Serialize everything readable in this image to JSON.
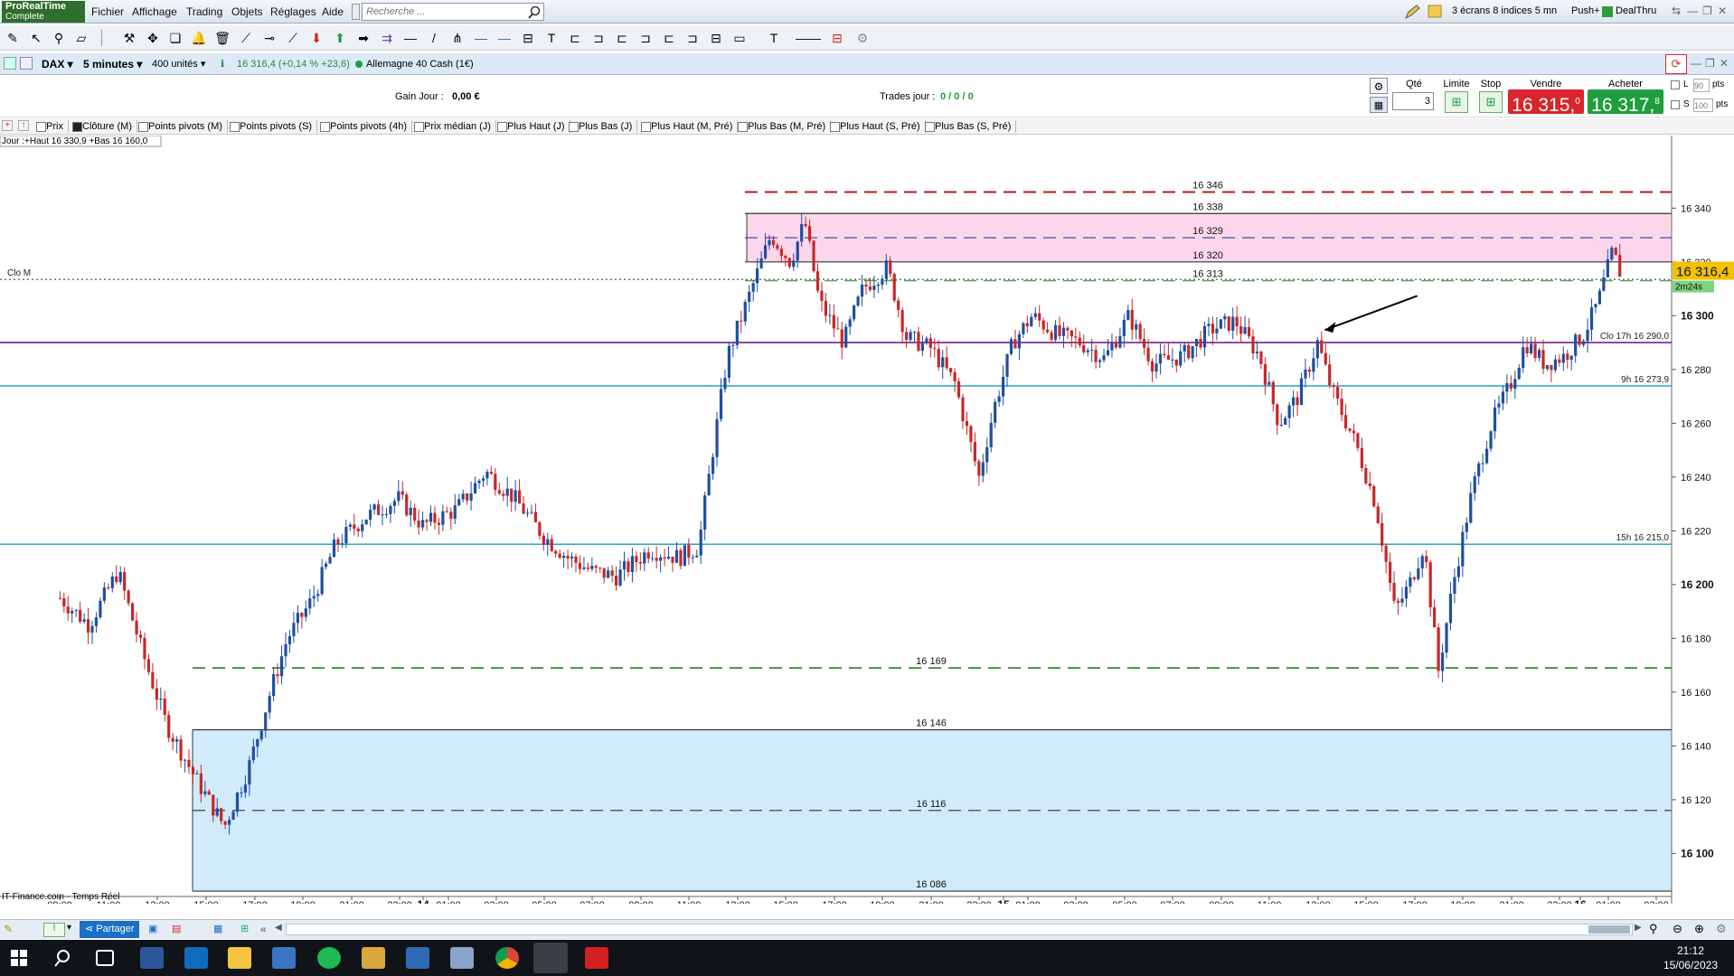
{
  "app": {
    "name": "ProRealTime",
    "edition": "Complete"
  },
  "menu": [
    "Fichier",
    "Affichage",
    "Trading",
    "Objets",
    "Réglages",
    "Aide"
  ],
  "search": {
    "placeholder": "Recherche ..."
  },
  "right_menu": {
    "layout": "3 écrans 8 indices 5 mn",
    "push": "Push+",
    "dealthru": "DealThru"
  },
  "instrument": {
    "symbol": "DAX",
    "timeframe": "5 minutes",
    "units": "400 unités",
    "last": "16 316,4 (+0,14 % +23,6)",
    "name": "Allemagne 40 Cash (1€)"
  },
  "info": {
    "gain_label": "Gain Jour :",
    "gain_value": "0,00 €",
    "trades_label": "Trades jour :",
    "trades_value": "0 / 0 / 0"
  },
  "order": {
    "qty_label": "Qté",
    "qty_value": "3",
    "limit_label": "Limite",
    "stop_label": "Stop",
    "sell_label": "Vendre",
    "sell_price": "16 315,",
    "sell_dec": "0",
    "buy_label": "Acheter",
    "buy_price": "16 317,",
    "buy_dec": "8",
    "l_label": "L",
    "l_value": "90",
    "s_label": "S",
    "s_value": "100",
    "pts": "pts"
  },
  "indicators": [
    {
      "label": "Prix",
      "on": false
    },
    {
      "label": "Clôture (M)",
      "on": true
    },
    {
      "label": "Points pivots (M)",
      "on": false
    },
    {
      "label": "Points pivots (S)",
      "on": false
    },
    {
      "label": "Points pivots (4h)",
      "on": false
    },
    {
      "label": "Prix médian (J)",
      "on": false
    },
    {
      "label": "Plus Haut (J)",
      "on": false
    },
    {
      "label": "Plus Bas (J)",
      "on": false
    },
    {
      "label": "Plus Haut (M, Pré)",
      "on": false
    },
    {
      "label": "Plus Bas (M, Pré)",
      "on": false
    },
    {
      "label": "Plus Haut (S, Pré)",
      "on": false
    },
    {
      "label": "Plus Bas (S, Pré)",
      "on": false
    }
  ],
  "chart_data": {
    "type": "candlestick",
    "interval": "5 minutes",
    "day_info": "Jour :+Haut 16 330,9 +Bas 16 160,0",
    "source": "IT-Finance.com - Temps Réel",
    "ylim": [
      16084,
      16367
    ],
    "y_ticks": [
      16100,
      16120,
      16140,
      16160,
      16180,
      16200,
      16220,
      16240,
      16260,
      16280,
      16300,
      16320,
      16340
    ],
    "y_tick_labels": [
      "16 100",
      "16 120",
      "16 140",
      "16 160",
      "16 180",
      "16 200",
      "16 220",
      "16 240",
      "16 260",
      "16 280",
      "16 300",
      "16 320",
      "16 340"
    ],
    "bold_ticks": [
      16100,
      16200,
      16300
    ],
    "x_ticks": [
      "09:00",
      "11:00",
      "13:00",
      "15:00",
      "17:00",
      "19:00",
      "21:00",
      "23:00",
      "14",
      "01:00",
      "03:00",
      "05:00",
      "07:00",
      "09:00",
      "11:00",
      "13:00",
      "15:00",
      "17:00",
      "19:00",
      "21:00",
      "23:00",
      "15",
      "01:00",
      "03:00",
      "05:00",
      "07:00",
      "09:00",
      "11:00",
      "13:00",
      "15:00",
      "17:00",
      "19:00",
      "21:00",
      "23:00",
      "16",
      "01:00",
      "03:00"
    ],
    "last_price": {
      "value": 16316.4,
      "label": "16 316,4",
      "countdown": "2m24s"
    },
    "horizontal_lines": [
      {
        "label": "Clo M",
        "value": 16313.5,
        "color": "#444444",
        "style": "dotted"
      },
      {
        "label": "Clo 17h 16 290,0",
        "value": 16290.0,
        "color": "#7a1f8f",
        "style": "solid"
      },
      {
        "label": "9h 16 273,9",
        "value": 16273.9,
        "color": "#2aa3c8",
        "style": "solid"
      },
      {
        "label": "15h 16 215,0",
        "value": 16215.0,
        "color": "#2aa3c8",
        "style": "solid"
      }
    ],
    "zones": [
      {
        "name": "resistance",
        "from": 16320,
        "to": 16338,
        "color": "#fcd7ec",
        "levels": [
          {
            "value": 16346,
            "label": "16 346",
            "color": "#c01818",
            "style": "dashed"
          },
          {
            "value": 16338,
            "label": "16 338",
            "color": "#333333",
            "style": "solid"
          },
          {
            "value": 16329,
            "label": "16 329",
            "color": "#2a3f9c",
            "style": "dashed"
          },
          {
            "value": 16320,
            "label": "16 320",
            "color": "#333333",
            "style": "solid"
          },
          {
            "value": 16313,
            "label": "16 313",
            "color": "#3a9a3a",
            "style": "dashed"
          }
        ]
      },
      {
        "name": "support",
        "from": 16086,
        "to": 16146,
        "color": "#d2ebfb",
        "levels": [
          {
            "value": 16169,
            "label": "16 169",
            "color": "#3a9a3a",
            "style": "dashed"
          },
          {
            "value": 16146,
            "label": "16 146",
            "color": "#333333",
            "style": "solid"
          },
          {
            "value": 16116,
            "label": "16 116",
            "color": "#333333",
            "style": "dashed"
          },
          {
            "value": 16086,
            "label": "16 086",
            "color": "#333333",
            "style": "solid"
          }
        ]
      }
    ],
    "price_path": [
      [
        0.0,
        16195
      ],
      [
        0.6,
        16185
      ],
      [
        1.2,
        16205
      ],
      [
        1.7,
        16175
      ],
      [
        2.2,
        16148
      ],
      [
        2.8,
        16128
      ],
      [
        3.4,
        16110
      ],
      [
        3.9,
        16132
      ],
      [
        4.35,
        16160
      ],
      [
        4.7,
        16180
      ],
      [
        5.2,
        16194
      ],
      [
        5.7,
        16215
      ],
      [
        6.3,
        16225
      ],
      [
        7.0,
        16232
      ],
      [
        7.5,
        16222
      ],
      [
        8.2,
        16228
      ],
      [
        8.8,
        16242
      ],
      [
        9.4,
        16232
      ],
      [
        10.0,
        16218
      ],
      [
        10.5,
        16210
      ],
      [
        11.0,
        16205
      ],
      [
        11.5,
        16203
      ],
      [
        12.2,
        16213
      ],
      [
        12.8,
        16210
      ],
      [
        13.2,
        16214
      ],
      [
        13.5,
        16250
      ],
      [
        13.8,
        16285
      ],
      [
        14.2,
        16305
      ],
      [
        14.7,
        16330
      ],
      [
        15.1,
        16320
      ],
      [
        15.4,
        16335
      ],
      [
        15.7,
        16305
      ],
      [
        16.2,
        16290
      ],
      [
        16.6,
        16310
      ],
      [
        17.1,
        16318
      ],
      [
        17.5,
        16292
      ],
      [
        18.0,
        16288
      ],
      [
        18.5,
        16275
      ],
      [
        19.0,
        16240
      ],
      [
        19.3,
        16265
      ],
      [
        19.7,
        16290
      ],
      [
        20.1,
        16300
      ],
      [
        20.6,
        16293
      ],
      [
        21.1,
        16290
      ],
      [
        21.6,
        16284
      ],
      [
        22.1,
        16300
      ],
      [
        22.6,
        16282
      ],
      [
        23.2,
        16285
      ],
      [
        23.8,
        16295
      ],
      [
        24.3,
        16298
      ],
      [
        24.8,
        16285
      ],
      [
        25.2,
        16260
      ],
      [
        25.6,
        16270
      ],
      [
        26.0,
        16290
      ],
      [
        26.3,
        16272
      ],
      [
        26.8,
        16252
      ],
      [
        27.2,
        16230
      ],
      [
        27.6,
        16190
      ],
      [
        27.9,
        16200
      ],
      [
        28.2,
        16215
      ],
      [
        28.5,
        16168
      ],
      [
        28.8,
        16200
      ],
      [
        29.2,
        16235
      ],
      [
        29.6,
        16260
      ],
      [
        30.0,
        16275
      ],
      [
        30.3,
        16290
      ],
      [
        30.7,
        16282
      ],
      [
        31.1,
        16285
      ],
      [
        31.5,
        16293
      ],
      [
        31.8,
        16305
      ],
      [
        32.1,
        16324
      ],
      [
        32.25,
        16316.4
      ]
    ],
    "annotation": {
      "type": "arrow",
      "at_hour": 26.0,
      "at_value": 16296,
      "from_hour": 27.5,
      "from_value": 16306
    }
  },
  "bottom": {
    "share_label": "Partager"
  },
  "taskbar": {
    "time": "21:12",
    "date": "15/06/2023"
  },
  "colors": {
    "up": "#1f4fa0",
    "down": "#c62828",
    "sell": "#d8262c",
    "buy": "#1e9e3c"
  }
}
